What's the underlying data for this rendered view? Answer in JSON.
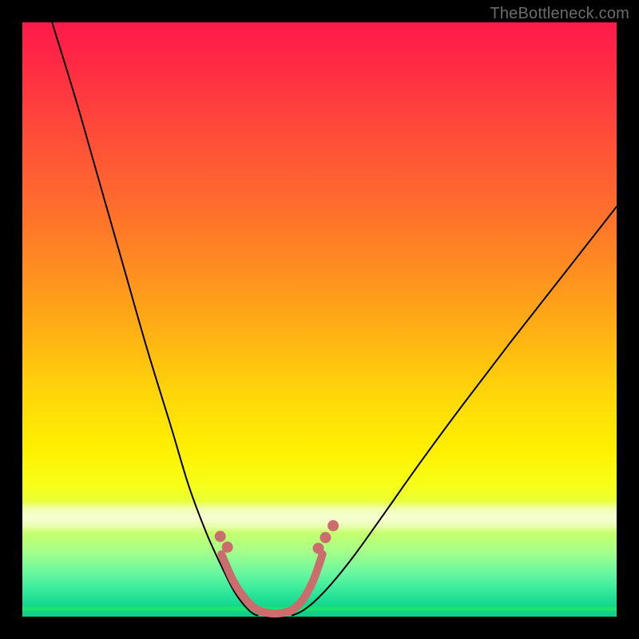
{
  "watermark": {
    "text": "TheBottleneck.com"
  },
  "chart_data": {
    "type": "line",
    "title": "",
    "xlabel": "",
    "ylabel": "",
    "xlim": [
      0,
      100
    ],
    "ylim": [
      0,
      100
    ],
    "grid": false,
    "legend": false,
    "annotations": [],
    "background_gradient": {
      "direction": "top-to-bottom",
      "stops": [
        {
          "pos": 0,
          "color": "#ff1a4b"
        },
        {
          "pos": 50,
          "color": "#ffb412"
        },
        {
          "pos": 82,
          "color": "#fffccf"
        },
        {
          "pos": 100,
          "color": "#0ece86"
        }
      ]
    },
    "series": [
      {
        "name": "left-descending-curve",
        "color": "#000000",
        "x": [
          5,
          9,
          13,
          17,
          21,
          25,
          28,
          31,
          33.5,
          35.5,
          37,
          38.2,
          39,
          39.6
        ],
        "y": [
          100,
          87,
          73,
          59,
          45,
          32,
          22,
          14,
          8.5,
          4.5,
          2.3,
          1.0,
          0.4,
          0.2
        ]
      },
      {
        "name": "right-ascending-curve",
        "color": "#000000",
        "x": [
          45.4,
          47,
          49,
          52,
          56,
          61,
          67,
          74,
          82,
          91,
          100
        ],
        "y": [
          0.2,
          0.9,
          2.4,
          5.5,
          10.5,
          17.5,
          26,
          35.5,
          46,
          57.5,
          69
        ]
      },
      {
        "name": "trough-marker-outline",
        "type": "line",
        "color": "#cb6d6d",
        "stroke_width": 10,
        "x": [
          33.5,
          35.5,
          37.5,
          39.5,
          41.5,
          43.5,
          45.5,
          47.3,
          49.0,
          50.5
        ],
        "y": [
          10.5,
          6.0,
          3.0,
          1.2,
          0.6,
          0.6,
          1.2,
          3.0,
          6.2,
          10.5
        ]
      },
      {
        "name": "left-dots",
        "type": "scatter",
        "color": "#cb6d6d",
        "radius": 7,
        "x": [
          33.3,
          34.5
        ],
        "y": [
          13.5,
          11.7
        ]
      },
      {
        "name": "right-dots",
        "type": "scatter",
        "color": "#cb6d6d",
        "radius": 7,
        "x": [
          49.8,
          51.0,
          52.3
        ],
        "y": [
          11.5,
          13.3,
          15.3
        ]
      }
    ]
  }
}
